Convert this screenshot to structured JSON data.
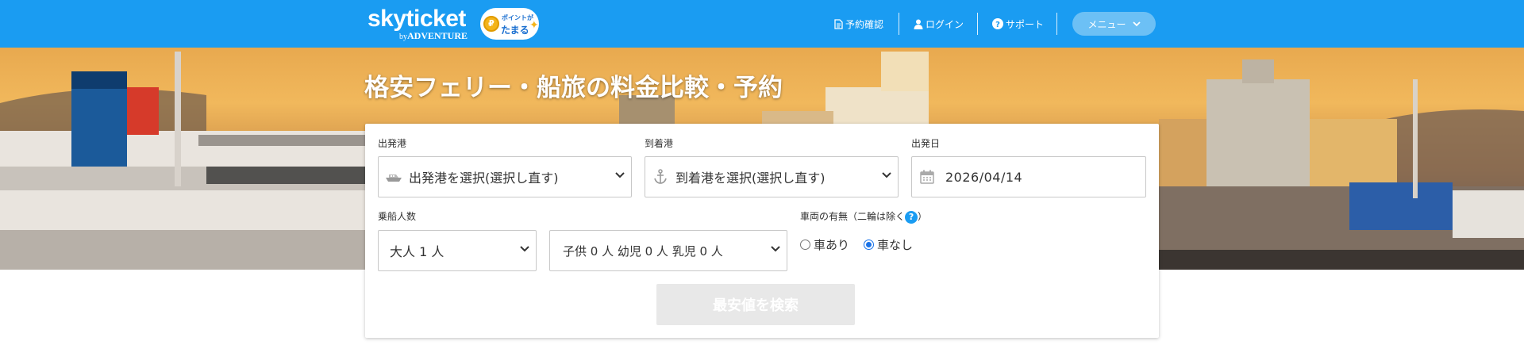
{
  "brand": {
    "logo_text": "skyticket",
    "logo_sub_by": "by",
    "logo_sub_name": "ADVENTURE",
    "points_line1": "ポイントが",
    "points_line2": "たまる"
  },
  "nav": {
    "reservation_check": "予約確認",
    "login": "ログイン",
    "support": "サポート",
    "menu": "メニュー"
  },
  "hero": {
    "title": "格安フェリー・船旅の料金比較・予約"
  },
  "form": {
    "departure_label": "出発港",
    "departure_value": "出発港を選択(選択し直す)",
    "arrival_label": "到着港",
    "arrival_value": "到着港を選択(選択し直す)",
    "date_label": "出発日",
    "date_value": "2026/04/14",
    "passengers_label": "乗船人数",
    "adults_value": "大人 1 人",
    "children_value": "子供 0 人 幼児 0 人 乳児 0 人",
    "vehicle_label": "車両の有無（二輪は除く",
    "vehicle_label_close": "）",
    "help_mark": "?",
    "vehicle_yes": "車あり",
    "vehicle_no": "車なし",
    "vehicle_selected": "車なし",
    "search_button": "最安値を検索"
  },
  "colors": {
    "header_bg": "#1a9cf2",
    "menu_button_bg": "#6cc0f5",
    "search_button_bg": "#e8e8e8",
    "radio_accent": "#1a73e8"
  }
}
